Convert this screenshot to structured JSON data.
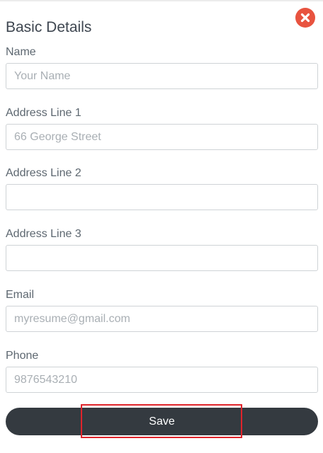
{
  "dialog": {
    "title": "Basic Details",
    "close_icon": "close-circle-icon",
    "close_color": "#e8533f"
  },
  "fields": [
    {
      "label": "Name",
      "value": "",
      "placeholder": "Your Name"
    },
    {
      "label": "Address Line 1",
      "value": "",
      "placeholder": "66 George Street"
    },
    {
      "label": "Address Line 2",
      "value": "",
      "placeholder": ""
    },
    {
      "label": "Address Line 3",
      "value": "",
      "placeholder": ""
    },
    {
      "label": "Email",
      "value": "",
      "placeholder": "myresume@gmail.com"
    },
    {
      "label": "Phone",
      "value": "",
      "placeholder": "9876543210"
    }
  ],
  "actions": {
    "save_label": "Save",
    "save_color": "#343a40",
    "highlight_color": "#e0242b"
  }
}
